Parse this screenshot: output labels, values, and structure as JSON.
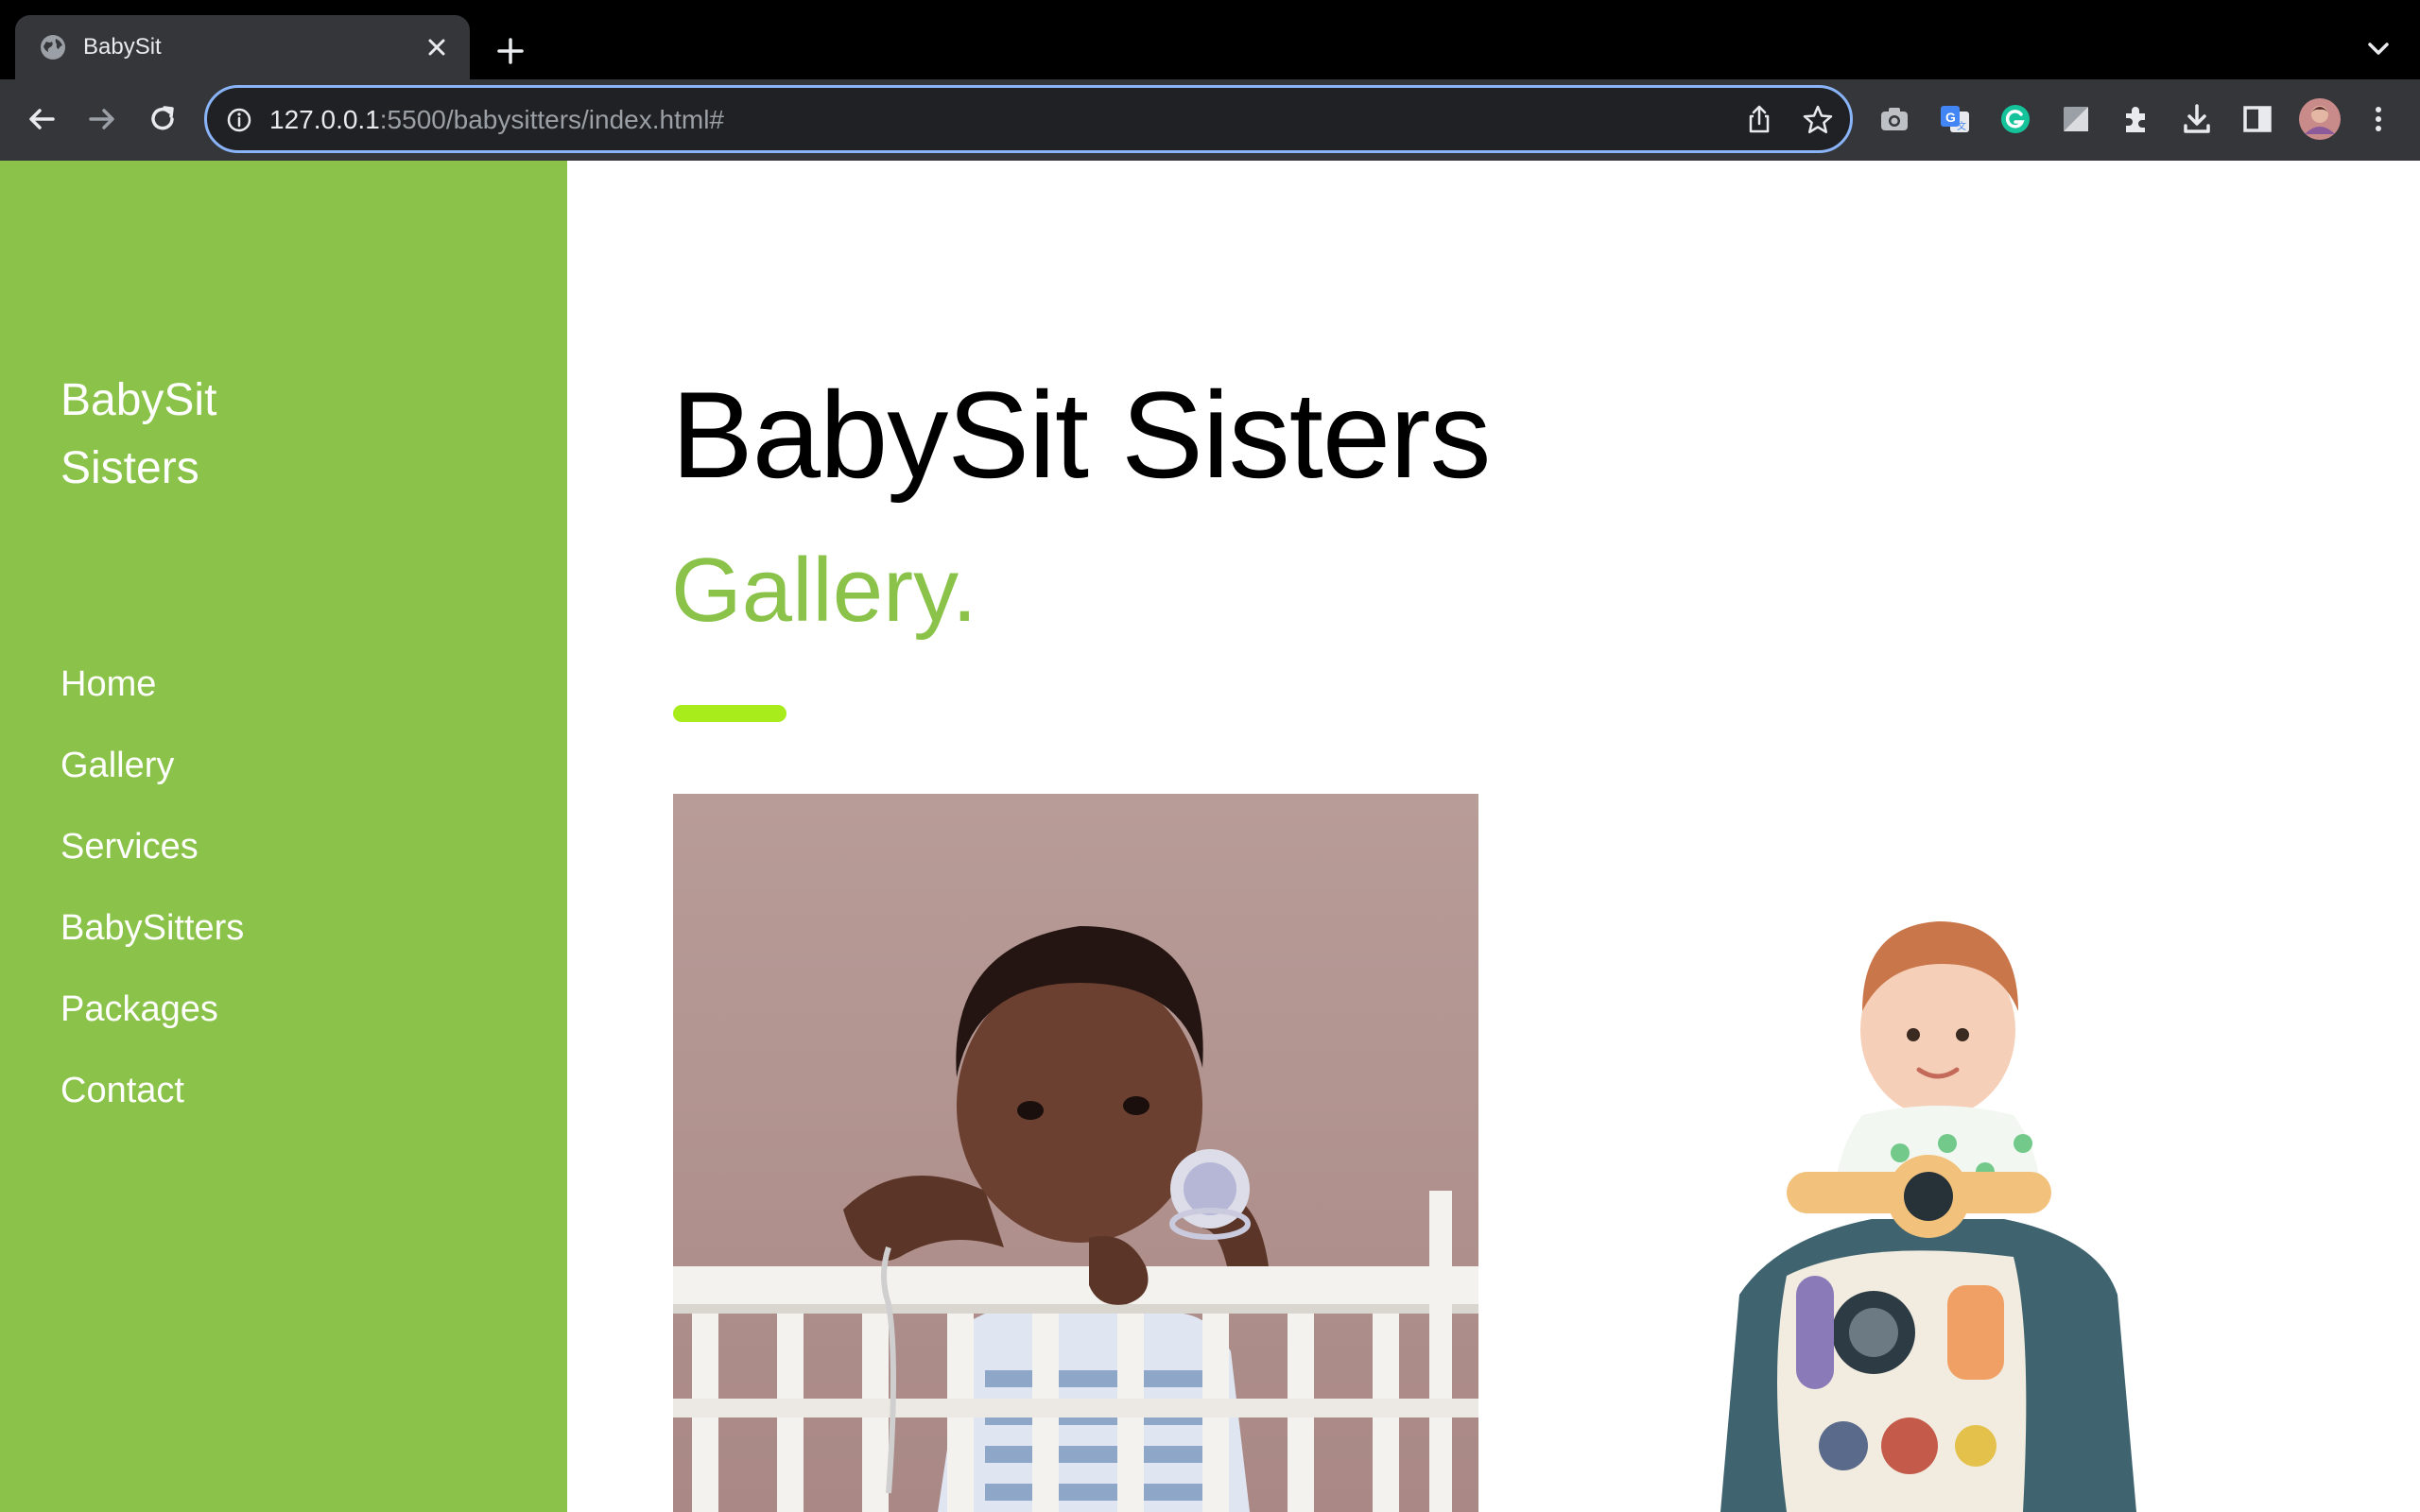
{
  "browser": {
    "tab_title": "BabySit",
    "url_host": "127.0.0.1",
    "url_rest": ":5500/babysitters/index.html#",
    "accent_color": "#8ab4f8"
  },
  "sidebar": {
    "brand": "BabySit Sisters",
    "color": "#8bc34a",
    "nav": [
      {
        "label": "Home"
      },
      {
        "label": "Gallery"
      },
      {
        "label": "Services"
      },
      {
        "label": "BabySitters"
      },
      {
        "label": "Packages"
      },
      {
        "label": "Contact"
      }
    ]
  },
  "main": {
    "title": "BabySit Sisters",
    "subtitle": "Gallery.",
    "accent_color": "#a8ec1c",
    "gallery": [
      {
        "icon": "baby-in-crib-photo"
      },
      {
        "icon": "toddler-with-walker-photo"
      }
    ]
  }
}
